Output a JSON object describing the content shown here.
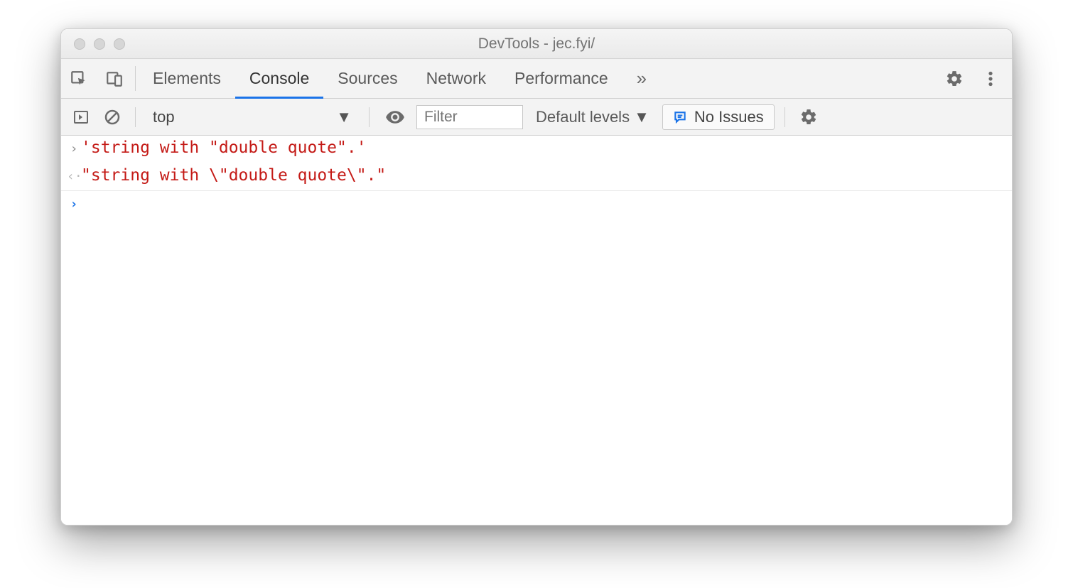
{
  "window": {
    "title": "DevTools - jec.fyi/"
  },
  "tabs": {
    "elements": "Elements",
    "console": "Console",
    "sources": "Sources",
    "network": "Network",
    "performance": "Performance"
  },
  "subbar": {
    "context": "top",
    "filter_placeholder": "Filter",
    "levels": "Default levels",
    "issues": "No Issues"
  },
  "console": {
    "input_line": "'string with \"double quote\".'",
    "output_line": "\"string with \\\"double quote\\\".\""
  }
}
